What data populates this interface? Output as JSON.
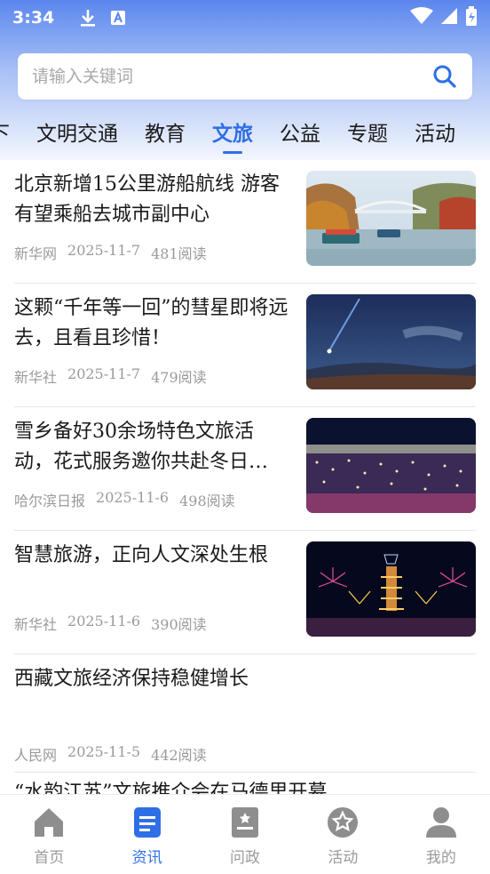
{
  "status_bar": {
    "time": "3:34",
    "icons": [
      "download-icon",
      "app-a-icon"
    ],
    "right_icons": [
      "wifi-icon",
      "signal-icon",
      "battery-icon"
    ]
  },
  "search": {
    "placeholder": "请输入关键词",
    "icon": "search-icon"
  },
  "tabs": [
    {
      "label": "下",
      "active": false
    },
    {
      "label": "文明交通",
      "active": false
    },
    {
      "label": "教育",
      "active": false
    },
    {
      "label": "文旅",
      "active": true
    },
    {
      "label": "公益",
      "active": false
    },
    {
      "label": "专题",
      "active": false
    },
    {
      "label": "活动",
      "active": false
    }
  ],
  "news": [
    {
      "title": "北京新增15公里游船航线 游客有望乘船去城市副中心",
      "source": "新华网",
      "date": "2025-11-7",
      "reads": "481阅读"
    },
    {
      "title": "这颗“千年等一回”的彗星即将远去，且看且珍惜！",
      "source": "新华社",
      "date": "2025-11-7",
      "reads": "479阅读"
    },
    {
      "title": "雪乡备好30余场特色文旅活动，花式服务邀你共赴冬日…",
      "source": "哈尔滨日报",
      "date": "2025-11-6",
      "reads": "498阅读"
    },
    {
      "title": "智慧旅游，正向人文深处生根",
      "source": "新华社",
      "date": "2025-11-6",
      "reads": "390阅读"
    },
    {
      "title": "西藏文旅经济保持稳健增长",
      "source": "人民网",
      "date": "2025-11-5",
      "reads": "442阅读"
    },
    {
      "title": "“水韵江苏”文旅推介会在马德里开幕"
    }
  ],
  "bottom_nav": [
    {
      "label": "首页",
      "icon": "home-icon",
      "active": false
    },
    {
      "label": "资讯",
      "icon": "news-icon",
      "active": true
    },
    {
      "label": "问政",
      "icon": "inquiry-icon",
      "active": false
    },
    {
      "label": "活动",
      "icon": "star-badge-icon",
      "active": false
    },
    {
      "label": "我的",
      "icon": "user-icon",
      "active": false
    }
  ],
  "colors": {
    "accent": "#2f6fe6",
    "header_gradient_top": "#5b86ee",
    "inactive_icon": "#8e8e8e",
    "meta_text": "#9a9a9a"
  }
}
